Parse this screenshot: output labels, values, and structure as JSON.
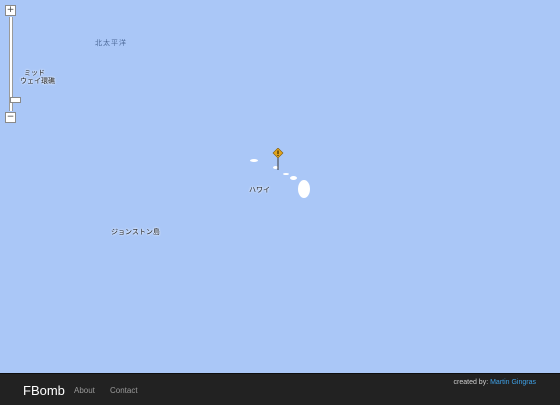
{
  "map": {
    "ocean_label": "北太平洋",
    "midway_label_line1": "ミッド",
    "midway_label_line2": "ウェイ環礁",
    "hawaii_label": "ハワイ",
    "johnston_label": "ジョンストン島",
    "zoom_in": "+",
    "zoom_out": "−",
    "water_color": "#aac7f7",
    "marker_color": "#e2a41c"
  },
  "footer": {
    "brand": "FBomb",
    "nav": [
      "About",
      "Contact"
    ],
    "credit_prefix": "created by",
    "credit_name": "Martin Gingras"
  }
}
